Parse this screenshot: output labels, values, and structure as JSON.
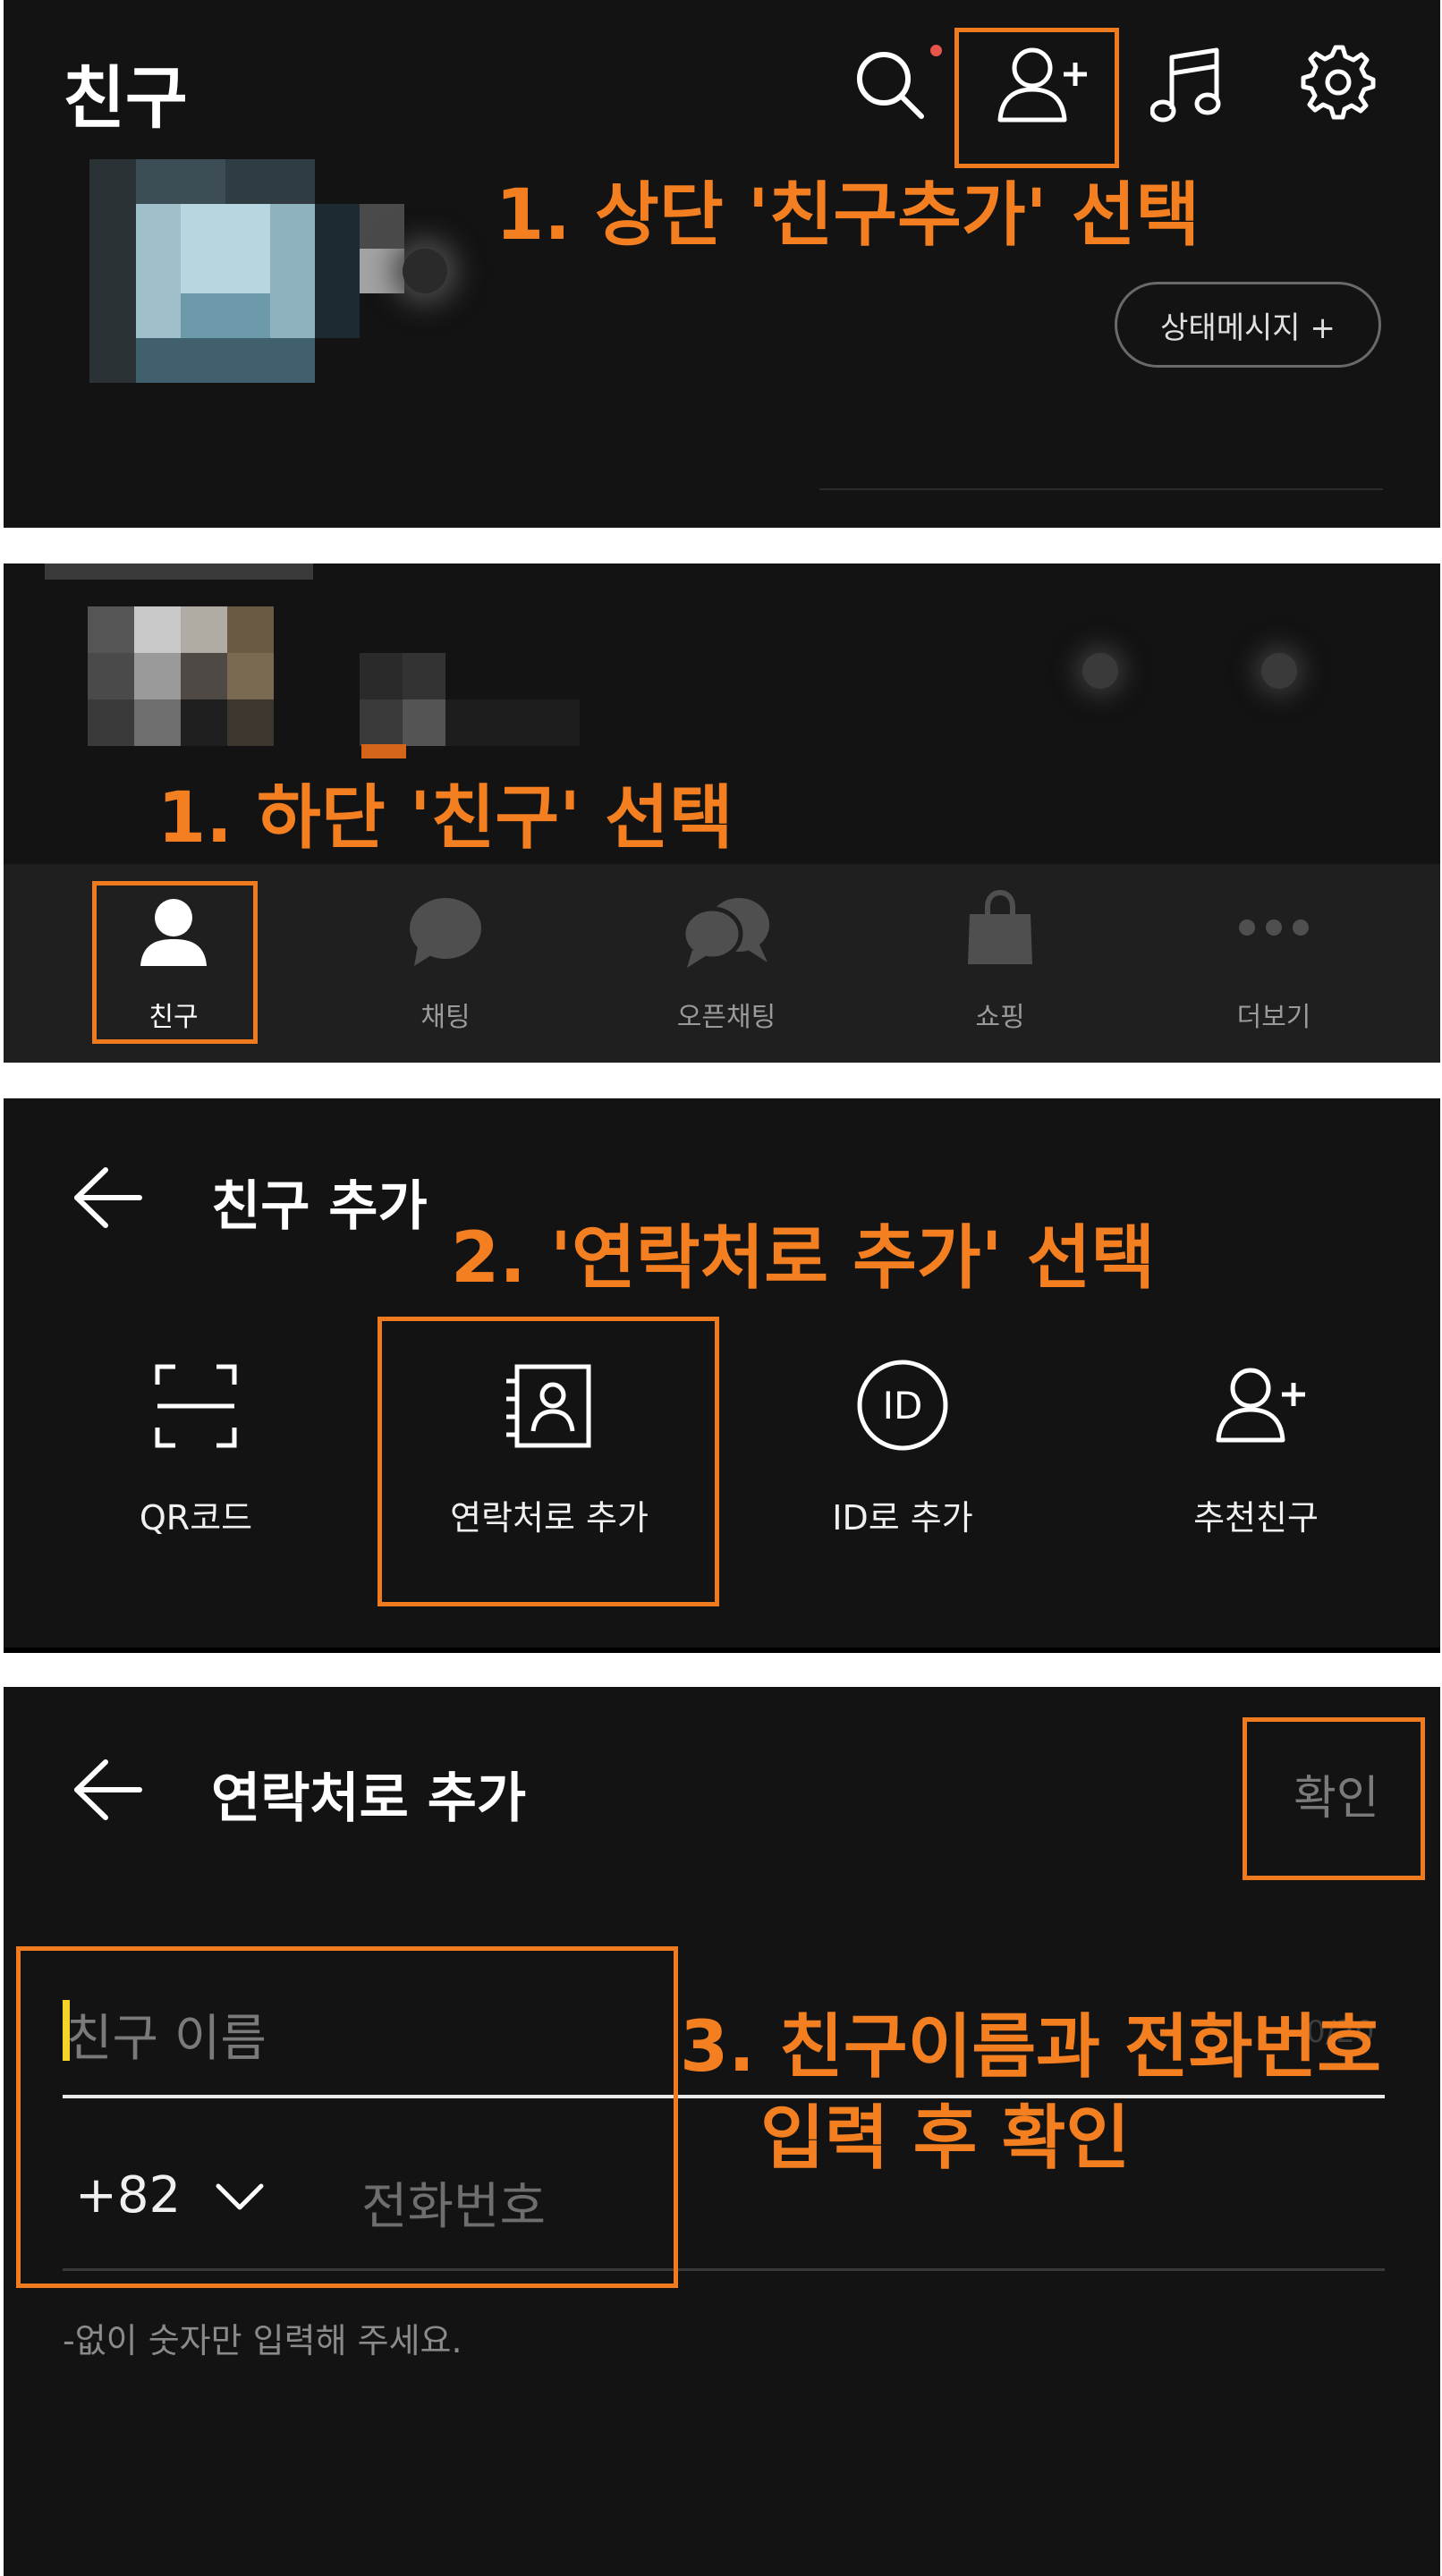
{
  "colors": {
    "background": "#131313",
    "accent_orange": "#f47f20",
    "box_orange": "#f07a1e",
    "text": "#ffffff",
    "muted": "#8a8a8a",
    "badge_red": "#e8554a"
  },
  "panel1": {
    "title": "친구",
    "annotation": "1. 상단 '친구추가' 선택",
    "status_button": "상태메시지 +",
    "icons": [
      "search-icon",
      "add-friend-icon",
      "music-icon",
      "settings-icon"
    ]
  },
  "panel2": {
    "annotation": "1. 하단 '친구' 선택",
    "tabs": [
      {
        "label": "친구",
        "icon": "person-icon",
        "active": true
      },
      {
        "label": "채팅",
        "icon": "chat-bubble-icon",
        "active": false
      },
      {
        "label": "오픈채팅",
        "icon": "open-chat-icon",
        "active": false
      },
      {
        "label": "쇼핑",
        "icon": "shopping-bag-icon",
        "active": false
      },
      {
        "label": "더보기",
        "icon": "more-dots-icon",
        "active": false
      }
    ]
  },
  "panel3": {
    "title": "친구 추가",
    "annotation": "2. '연락처로 추가' 선택",
    "options": [
      {
        "label": "QR코드",
        "icon": "qr-scan-icon"
      },
      {
        "label": "연락처로 추가",
        "icon": "contact-book-icon"
      },
      {
        "label": "ID로 추가",
        "icon": "id-circle-icon"
      },
      {
        "label": "추천친구",
        "icon": "add-friend-icon"
      }
    ]
  },
  "panel4": {
    "title": "연락처로 추가",
    "confirm": "확인",
    "name_placeholder": "친구 이름",
    "name_counter": "0/20",
    "country_code": "+82",
    "phone_placeholder": "전화번호",
    "hint": "-없이 숫자만 입력해 주세요.",
    "annotation_line1": "3. 친구이름과 전화번호",
    "annotation_line2": "입력 후 확인"
  }
}
